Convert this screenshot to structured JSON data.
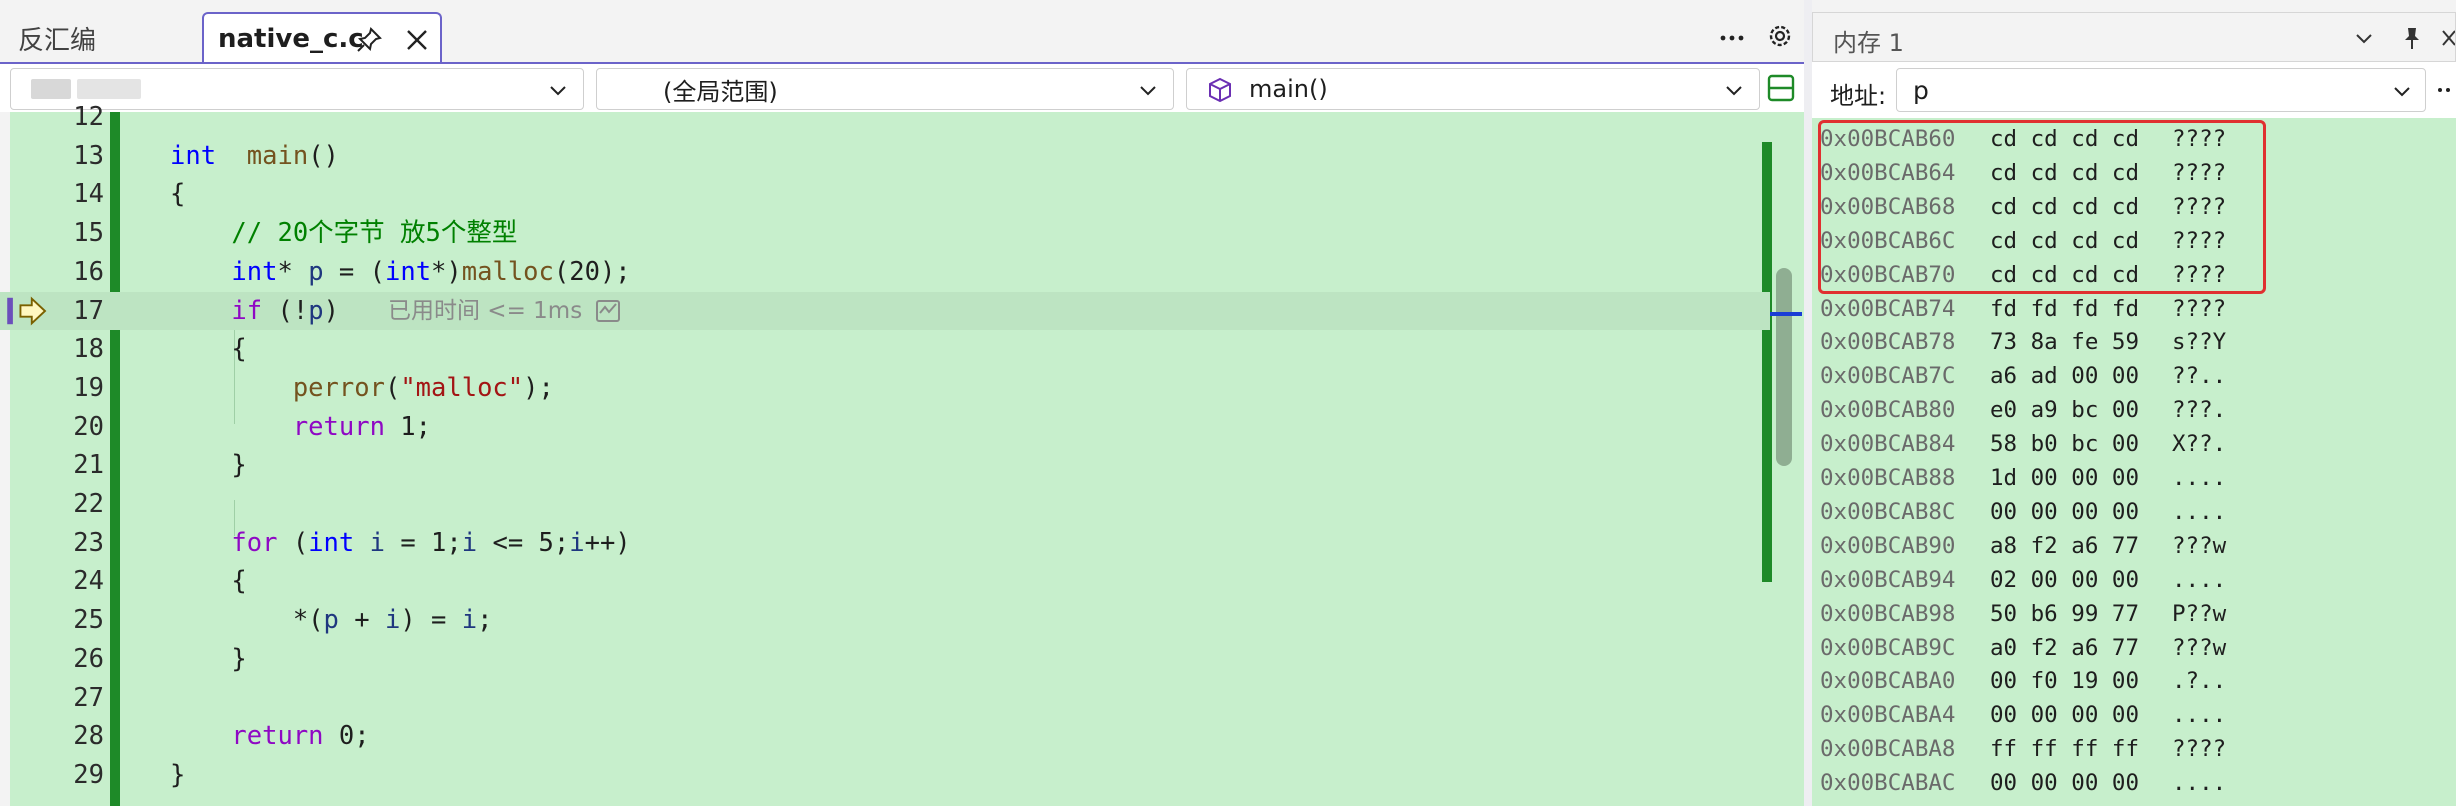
{
  "editor": {
    "tabs": [
      {
        "label": "反汇编",
        "active": false
      },
      {
        "label": "native_c.c",
        "active": true
      }
    ],
    "nav": {
      "project_label": "",
      "scope_label": "(全局范围)",
      "function_label": "main()"
    },
    "perf_tip": "已用时间 <= 1ms",
    "lines": [
      {
        "n": "12",
        "t": []
      },
      {
        "n": "13",
        "t": [
          [
            "kw",
            "int"
          ],
          [
            "",
            "  "
          ],
          [
            "fn",
            "main"
          ],
          [
            "",
            "()"
          ]
        ]
      },
      {
        "n": "14",
        "t": [
          [
            "",
            "{"
          ]
        ]
      },
      {
        "n": "15",
        "t": [
          [
            "cm",
            "    // 20个字节 放5个整型"
          ]
        ]
      },
      {
        "n": "16",
        "t": [
          [
            "",
            "    "
          ],
          [
            "kw",
            "int"
          ],
          [
            "",
            "* "
          ],
          [
            "id",
            "p"
          ],
          [
            "",
            " = ("
          ],
          [
            "kw",
            "int"
          ],
          [
            "",
            "*)"
          ],
          [
            "fn",
            "malloc"
          ],
          [
            "",
            "(20);"
          ]
        ]
      },
      {
        "n": "17",
        "t": [
          [
            "",
            "    "
          ],
          [
            "kw2",
            "if"
          ],
          [
            "",
            " (!"
          ],
          [
            "id",
            "p"
          ],
          [
            "",
            ")"
          ]
        ]
      },
      {
        "n": "18",
        "t": [
          [
            "",
            "    {"
          ]
        ]
      },
      {
        "n": "19",
        "t": [
          [
            "",
            "        "
          ],
          [
            "fn",
            "perror"
          ],
          [
            "",
            "("
          ],
          [
            "str",
            "\"malloc\""
          ],
          [
            "",
            ");"
          ]
        ]
      },
      {
        "n": "20",
        "t": [
          [
            "",
            "        "
          ],
          [
            "kw2",
            "return"
          ],
          [
            "",
            " 1;"
          ]
        ]
      },
      {
        "n": "21",
        "t": [
          [
            "",
            "    }"
          ]
        ]
      },
      {
        "n": "22",
        "t": []
      },
      {
        "n": "23",
        "t": [
          [
            "",
            "    "
          ],
          [
            "kw2",
            "for"
          ],
          [
            "",
            " ("
          ],
          [
            "kw",
            "int"
          ],
          [
            "",
            ""
          ],
          [
            "",
            " "
          ],
          [
            "id",
            "i"
          ],
          [
            "",
            " = 1;"
          ],
          [
            "id",
            "i"
          ],
          [
            "",
            " <= 5;"
          ],
          [
            "id",
            "i"
          ],
          [
            "",
            "++)"
          ]
        ]
      },
      {
        "n": "24",
        "t": [
          [
            "",
            "    {"
          ]
        ]
      },
      {
        "n": "25",
        "t": [
          [
            "",
            "        *("
          ],
          [
            "id",
            "p"
          ],
          [
            "",
            " + "
          ],
          [
            "id",
            "i"
          ],
          [
            "",
            ") = "
          ],
          [
            "id",
            "i"
          ],
          [
            "",
            ";"
          ]
        ]
      },
      {
        "n": "26",
        "t": [
          [
            "",
            "    }"
          ]
        ]
      },
      {
        "n": "27",
        "t": []
      },
      {
        "n": "28",
        "t": [
          [
            "",
            "    "
          ],
          [
            "kw2",
            "return"
          ],
          [
            "",
            " 0;"
          ]
        ]
      },
      {
        "n": "29",
        "t": [
          [
            "",
            "}"
          ]
        ]
      }
    ]
  },
  "memory": {
    "title": "内存 1",
    "address_label": "地址:",
    "address_value": "p",
    "rows": [
      [
        "0x00BCAB60",
        "cd cd cd cd",
        "????"
      ],
      [
        "0x00BCAB64",
        "cd cd cd cd",
        "????"
      ],
      [
        "0x00BCAB68",
        "cd cd cd cd",
        "????"
      ],
      [
        "0x00BCAB6C",
        "cd cd cd cd",
        "????"
      ],
      [
        "0x00BCAB70",
        "cd cd cd cd",
        "????"
      ],
      [
        "0x00BCAB74",
        "fd fd fd fd",
        "????"
      ],
      [
        "0x00BCAB78",
        "73 8a fe 59",
        "s??Y"
      ],
      [
        "0x00BCAB7C",
        "a6 ad 00 00",
        "??.."
      ],
      [
        "0x00BCAB80",
        "e0 a9 bc 00",
        "???."
      ],
      [
        "0x00BCAB84",
        "58 b0 bc 00",
        "X??."
      ],
      [
        "0x00BCAB88",
        "1d 00 00 00",
        "...."
      ],
      [
        "0x00BCAB8C",
        "00 00 00 00",
        "...."
      ],
      [
        "0x00BCAB90",
        "a8 f2 a6 77",
        "???w"
      ],
      [
        "0x00BCAB94",
        "02 00 00 00",
        "...."
      ],
      [
        "0x00BCAB98",
        "50 b6 99 77",
        "P??w"
      ],
      [
        "0x00BCAB9C",
        "a0 f2 a6 77",
        "???w"
      ],
      [
        "0x00BCABA0",
        "00 f0 19 00",
        ".?.."
      ],
      [
        "0x00BCABA4",
        "00 00 00 00",
        "...."
      ],
      [
        "0x00BCABA8",
        "ff ff ff ff",
        "????"
      ],
      [
        "0x00BCABAC",
        "00 00 00 00",
        "...."
      ]
    ]
  }
}
